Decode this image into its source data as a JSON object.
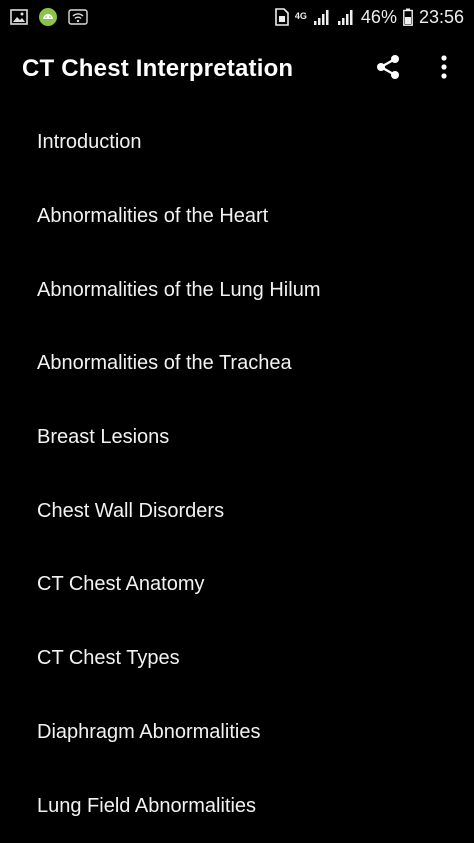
{
  "status_bar": {
    "network": "4G",
    "battery": "46%",
    "time": "23:56",
    "left_icons": [
      "gallery-icon",
      "android-icon",
      "wifi-icon"
    ]
  },
  "app_bar": {
    "title": "CT Chest Interpretation",
    "actions": [
      "share-icon",
      "more-vert-icon"
    ]
  },
  "menu": {
    "items": [
      {
        "label": "Introduction"
      },
      {
        "label": "Abnormalities of the Heart"
      },
      {
        "label": "Abnormalities of the Lung Hilum"
      },
      {
        "label": "Abnormalities of the Trachea"
      },
      {
        "label": "Breast Lesions"
      },
      {
        "label": "Chest Wall Disorders"
      },
      {
        "label": "CT Chest Anatomy"
      },
      {
        "label": "CT Chest Types"
      },
      {
        "label": "Diaphragm Abnormalities"
      },
      {
        "label": "Lung Field Abnormalities"
      }
    ]
  },
  "colors": {
    "background": "#000000",
    "text": "#ffffff",
    "android_green": "#8bc34a"
  }
}
